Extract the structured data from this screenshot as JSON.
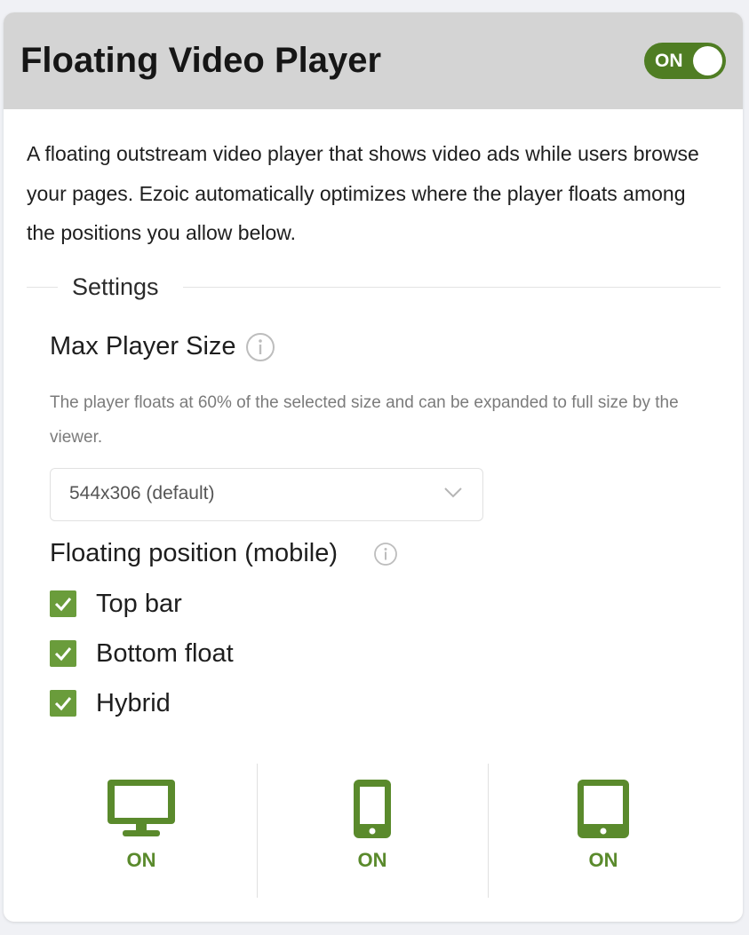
{
  "header": {
    "title": "Floating Video Player",
    "toggle_label": "ON"
  },
  "description": "A floating outstream video player that shows video ads while users browse your pages. Ezoic automatically optimizes where the player floats among the positions you allow below.",
  "settings": {
    "legend": "Settings",
    "max_player_size": {
      "label": "Max Player Size",
      "info_icon": "info-icon",
      "hint": "The player floats at 60% of the selected size and can be expanded to full size by the viewer.",
      "selected": "544x306 (default)"
    },
    "floating_position": {
      "label": "Floating position (mobile)",
      "info_icon": "info-icon",
      "options": [
        {
          "label": "Top bar",
          "checked": true
        },
        {
          "label": "Bottom float",
          "checked": true
        },
        {
          "label": "Hybrid",
          "checked": true
        }
      ]
    }
  },
  "devices": [
    {
      "name": "desktop",
      "icon": "desktop-icon",
      "status": "ON"
    },
    {
      "name": "mobile",
      "icon": "mobile-icon",
      "status": "ON"
    },
    {
      "name": "tablet",
      "icon": "tablet-icon",
      "status": "ON"
    }
  ],
  "colors": {
    "accent": "#4f7d23",
    "checkbox": "#6a9c3b",
    "status_on": "#5a8a2c",
    "header_bg": "#d4d4d4"
  }
}
